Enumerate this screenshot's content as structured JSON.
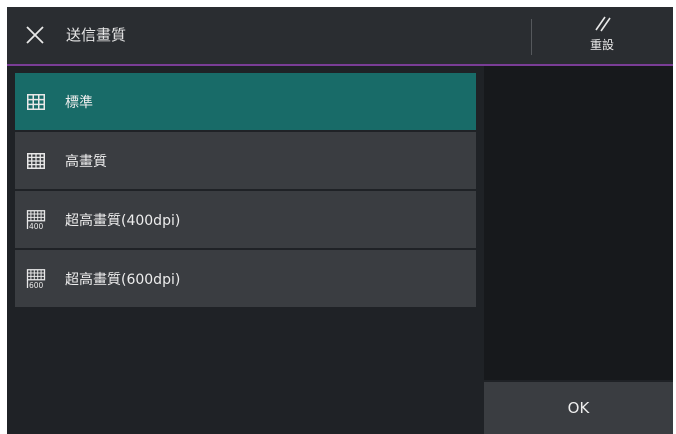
{
  "header": {
    "title": "送信畫質",
    "close_icon": "close-icon",
    "reset_icon": "reset-icon",
    "reset_label": "重設"
  },
  "options": [
    {
      "label": "標準",
      "icon": "grid-icon",
      "selected": true
    },
    {
      "label": "高畫質",
      "icon": "fine-grid-icon",
      "selected": false
    },
    {
      "label": "超高畫質(400dpi)",
      "icon": "grid-400-icon",
      "icon_text": "400",
      "selected": false
    },
    {
      "label": "超高畫質(600dpi)",
      "icon": "grid-600-icon",
      "icon_text": "600",
      "selected": false
    }
  ],
  "footer": {
    "ok_label": "OK"
  },
  "colors": {
    "selected": "#186b68",
    "item": "#3a3d41",
    "accent": "#7a3d96",
    "background": "#1f2226"
  }
}
